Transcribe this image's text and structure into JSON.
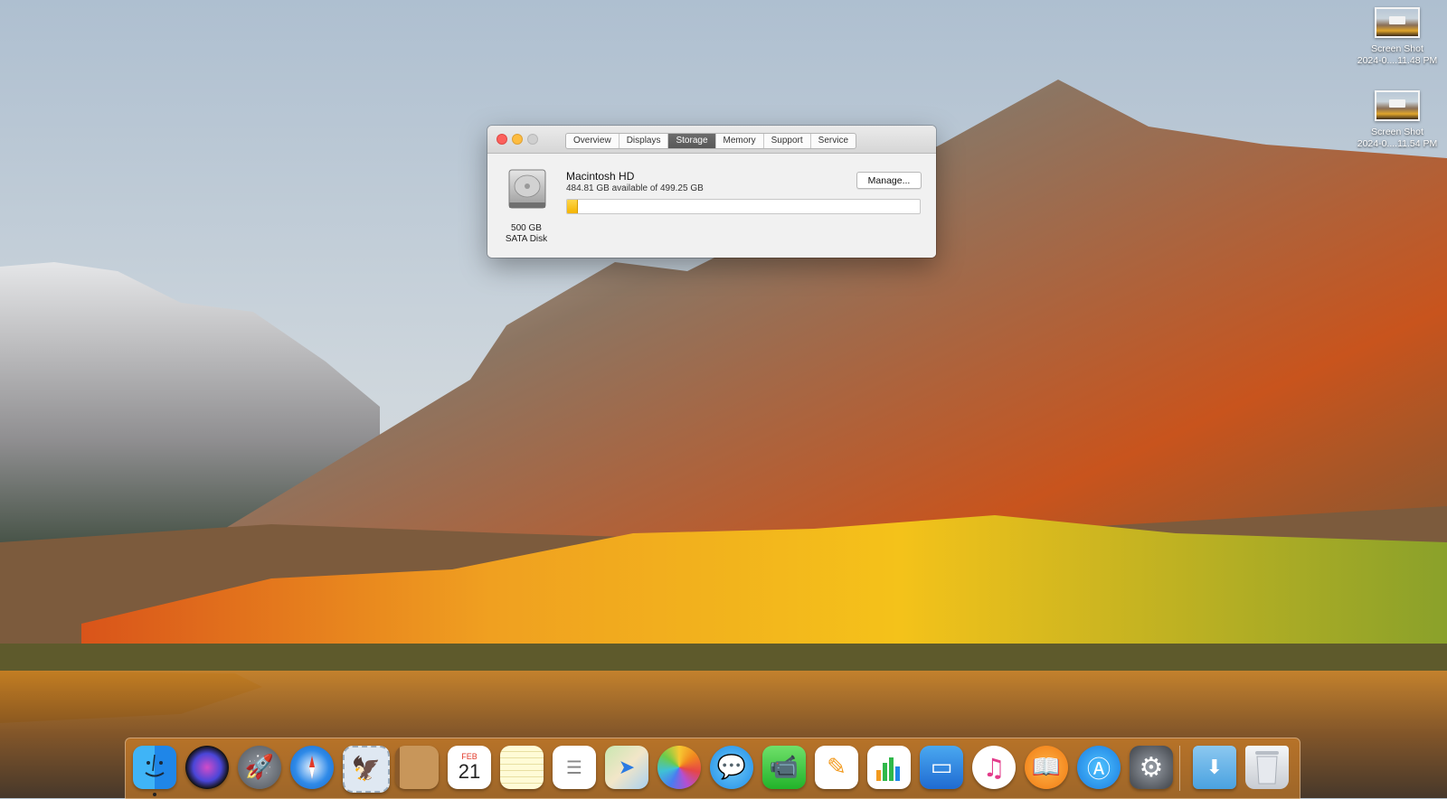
{
  "desktop": {
    "icons": [
      {
        "label_line1": "Screen Shot",
        "label_line2": "2024-0....11.48 PM"
      },
      {
        "label_line1": "Screen Shot",
        "label_line2": "2024-0....11.54 PM"
      }
    ]
  },
  "window": {
    "tabs": [
      "Overview",
      "Displays",
      "Storage",
      "Memory",
      "Support",
      "Service"
    ],
    "active_tab": "Storage",
    "disk": {
      "size": "500 GB",
      "type": "SATA Disk",
      "icon": "hard-drive-icon"
    },
    "volume": {
      "name": "Macintosh HD",
      "availability": "484.81 GB available of 499.25 GB",
      "used_fraction": 0.029
    },
    "manage_label": "Manage..."
  },
  "dock": {
    "items": [
      {
        "name": "finder",
        "icon": "finder-icon"
      },
      {
        "name": "siri",
        "icon": "siri-icon"
      },
      {
        "name": "launchpad",
        "icon": "rocket-icon"
      },
      {
        "name": "safari",
        "icon": "compass-icon"
      },
      {
        "name": "mail",
        "icon": "stamp-icon"
      },
      {
        "name": "contacts",
        "icon": "contacts-icon"
      },
      {
        "name": "calendar",
        "icon": "calendar-icon",
        "month": "FEB",
        "day": "21"
      },
      {
        "name": "notes",
        "icon": "notes-icon"
      },
      {
        "name": "reminders",
        "icon": "reminders-icon"
      },
      {
        "name": "maps",
        "icon": "map-icon"
      },
      {
        "name": "photos",
        "icon": "photos-icon"
      },
      {
        "name": "messages",
        "icon": "speech-bubble-icon"
      },
      {
        "name": "facetime",
        "icon": "video-camera-icon"
      },
      {
        "name": "pages",
        "icon": "pages-icon"
      },
      {
        "name": "numbers",
        "icon": "bar-chart-icon"
      },
      {
        "name": "keynote",
        "icon": "podium-icon"
      },
      {
        "name": "itunes",
        "icon": "music-note-icon"
      },
      {
        "name": "ibooks",
        "icon": "open-book-icon"
      },
      {
        "name": "app-store",
        "icon": "app-store-icon"
      },
      {
        "name": "system-preferences",
        "icon": "gear-icon"
      },
      {
        "name": "downloads",
        "icon": "download-folder-icon"
      },
      {
        "name": "trash",
        "icon": "trash-icon"
      }
    ]
  }
}
